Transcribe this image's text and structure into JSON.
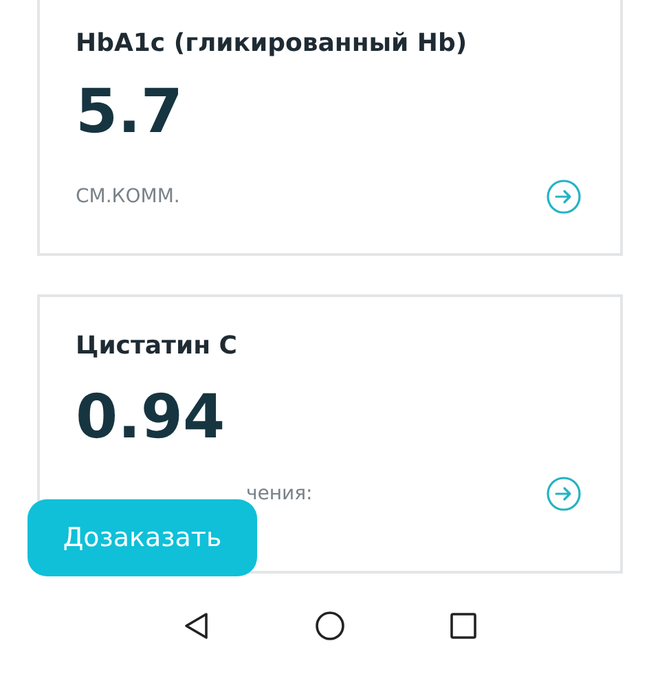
{
  "results": [
    {
      "title": "HbA1c (гликированный Hb)",
      "value": "5.7",
      "note": "СМ.КОММ."
    },
    {
      "title": "Цистатин С",
      "value": "0.94",
      "note": "чения:"
    }
  ],
  "order_button": {
    "label": "Дозаказать"
  }
}
